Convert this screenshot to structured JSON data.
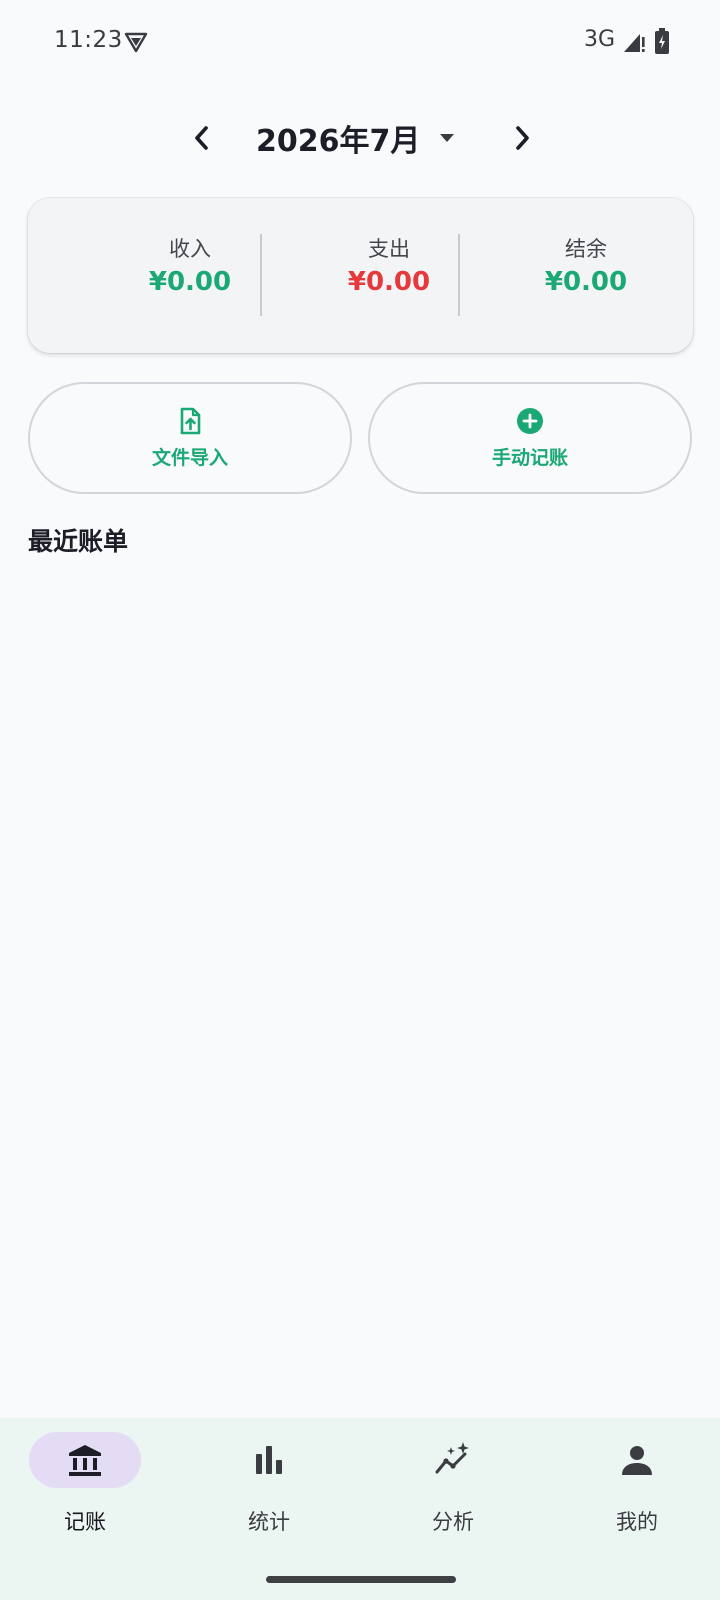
{
  "status": {
    "time": "11:23",
    "network": "3G",
    "icons": [
      "vpn-icon",
      "signal-icon",
      "battery-icon"
    ]
  },
  "month_header": {
    "title": "2026年7月",
    "icons": [
      "chevron-left-icon",
      "caret-down-icon",
      "chevron-right-icon"
    ]
  },
  "summary": {
    "income_label": "收入",
    "income_value": "¥0.00",
    "expense_label": "支出",
    "expense_value": "¥0.00",
    "balance_label": "结余",
    "balance_value": "¥0.00"
  },
  "actions": {
    "import_label": "文件导入",
    "manual_label": "手动记账",
    "import_icon": "file-upload-icon",
    "manual_icon": "add-circle-icon"
  },
  "recent": {
    "title": "最近账单"
  },
  "bottom_nav": {
    "items": [
      {
        "label": "记账",
        "icon": "bank-icon",
        "active": true
      },
      {
        "label": "统计",
        "icon": "bar-chart-icon",
        "active": false
      },
      {
        "label": "分析",
        "icon": "trend-sparkle-icon",
        "active": false
      },
      {
        "label": "我的",
        "icon": "person-icon",
        "active": false
      }
    ]
  },
  "colors": {
    "income": "#1aa874",
    "expense": "#e5393b",
    "balance": "#1aa874",
    "accent": "#1aa874",
    "nav_background": "#ebf6f2",
    "nav_active_pill": "#e4dcf5"
  }
}
